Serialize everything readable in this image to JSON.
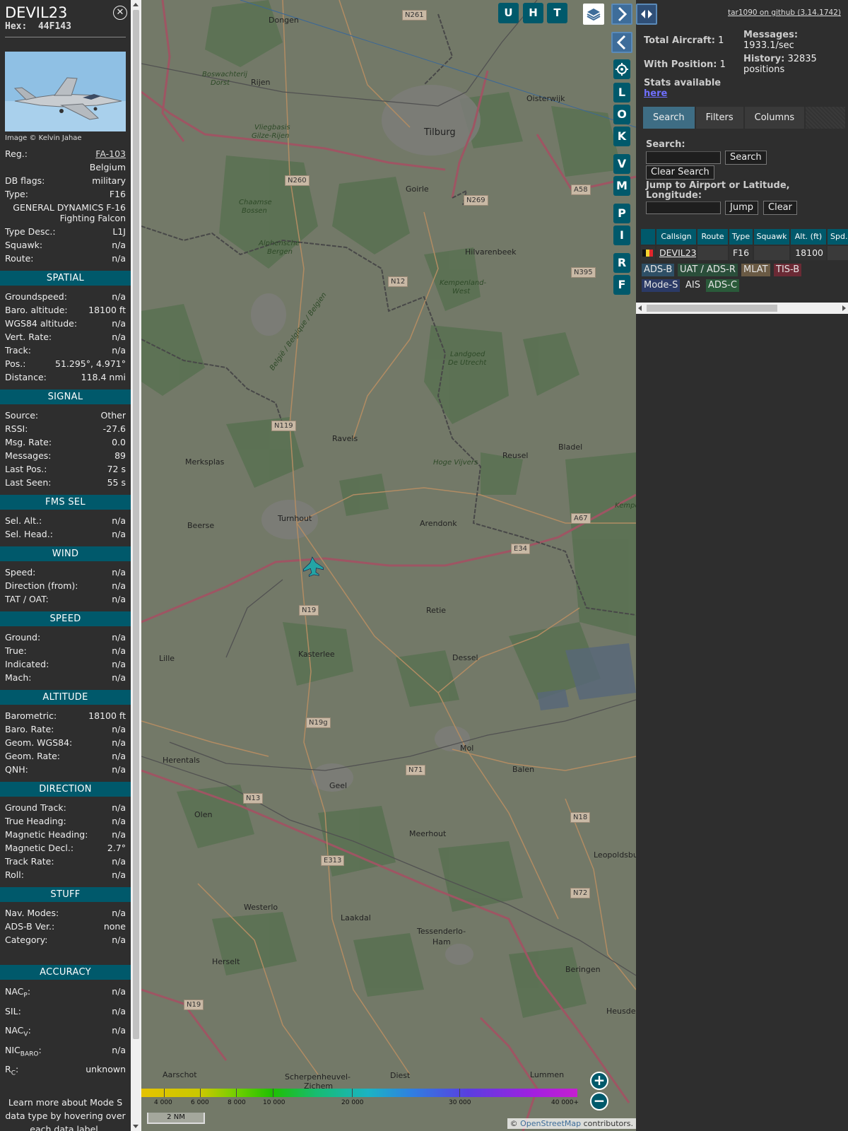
{
  "info": {
    "callsign": "DEVIL23",
    "hex_label": "Hex:",
    "hex": "44F143",
    "photo_credit": "Image © Kelvin Jahae",
    "close_icon": "close-icon",
    "top": [
      {
        "label": "Reg.:",
        "value": "FA-103",
        "link": true
      },
      {
        "label": "",
        "value": "Belgium"
      },
      {
        "label": "DB flags:",
        "value": "military"
      },
      {
        "label": "Type:",
        "value": "F16"
      },
      {
        "label": "",
        "value": "GENERAL DYNAMICS F-16 Fighting Falcon",
        "wrap": true
      },
      {
        "label": "Type Desc.:",
        "value": "L1J"
      },
      {
        "label": "Squawk:",
        "value": "n/a"
      },
      {
        "label": "Route:",
        "value": "n/a"
      }
    ],
    "sections": [
      {
        "title": "SPATIAL",
        "rows": [
          {
            "label": "Groundspeed:",
            "value": "n/a"
          },
          {
            "label": "Baro. altitude:",
            "value": "18100 ft"
          },
          {
            "label": "WGS84 altitude:",
            "value": "n/a"
          },
          {
            "label": "Vert. Rate:",
            "value": "n/a"
          },
          {
            "label": "Track:",
            "value": "n/a"
          },
          {
            "label": "Pos.:",
            "value": "51.295°, 4.971°"
          },
          {
            "label": "Distance:",
            "value": "118.4 nmi"
          }
        ]
      },
      {
        "title": "SIGNAL",
        "rows": [
          {
            "label": "Source:",
            "value": "Other"
          },
          {
            "label": "RSSI:",
            "value": "-27.6"
          },
          {
            "label": "Msg. Rate:",
            "value": "0.0"
          },
          {
            "label": "Messages:",
            "value": "89"
          },
          {
            "label": "Last Pos.:",
            "value": "72 s"
          },
          {
            "label": "Last Seen:",
            "value": "55 s"
          }
        ]
      },
      {
        "title": "FMS SEL",
        "rows": [
          {
            "label": "Sel. Alt.:",
            "value": "n/a"
          },
          {
            "label": "Sel. Head.:",
            "value": "n/a"
          }
        ]
      },
      {
        "title": "WIND",
        "rows": [
          {
            "label": "Speed:",
            "value": "n/a"
          },
          {
            "label": "Direction (from):",
            "value": "n/a"
          },
          {
            "label": "TAT / OAT:",
            "value": "n/a"
          }
        ]
      },
      {
        "title": "SPEED",
        "rows": [
          {
            "label": "Ground:",
            "value": "n/a"
          },
          {
            "label": "True:",
            "value": "n/a"
          },
          {
            "label": "Indicated:",
            "value": "n/a"
          },
          {
            "label": "Mach:",
            "value": "n/a"
          }
        ]
      },
      {
        "title": "ALTITUDE",
        "rows": [
          {
            "label": "Barometric:",
            "value": "18100 ft"
          },
          {
            "label": "Baro. Rate:",
            "value": "n/a"
          },
          {
            "label": "Geom. WGS84:",
            "value": "n/a"
          },
          {
            "label": "Geom. Rate:",
            "value": "n/a"
          },
          {
            "label": "QNH:",
            "value": "n/a"
          }
        ]
      },
      {
        "title": "DIRECTION",
        "rows": [
          {
            "label": "Ground Track:",
            "value": "n/a"
          },
          {
            "label": "True Heading:",
            "value": "n/a"
          },
          {
            "label": "Magnetic Heading:",
            "value": "n/a"
          },
          {
            "label": "Magnetic Decl.:",
            "value": "2.7°"
          },
          {
            "label": "Track Rate:",
            "value": "n/a"
          },
          {
            "label": "Roll:",
            "value": "n/a"
          }
        ]
      },
      {
        "title": "STUFF",
        "rows": [
          {
            "label": "Nav. Modes:",
            "value": "n/a"
          },
          {
            "label": "ADS-B Ver.:",
            "value": "none"
          },
          {
            "label": "Category:",
            "value": "n/a"
          }
        ]
      }
    ],
    "accuracy": {
      "title": "ACCURACY",
      "rows": [
        {
          "label": "NAC",
          "sub": "P",
          "tail": ":",
          "value": "n/a"
        },
        {
          "label": "SIL:",
          "sub": "",
          "tail": "",
          "value": "n/a"
        },
        {
          "label": "NAC",
          "sub": "V",
          "tail": ":",
          "value": "n/a"
        },
        {
          "label": "NIC",
          "sub": "BARO",
          "tail": ":",
          "value": "n/a"
        },
        {
          "label": "R",
          "sub": "C",
          "tail": ":",
          "value": "unknown"
        }
      ]
    },
    "learn_more": "Learn more about Mode S data type by hovering over each data label."
  },
  "map": {
    "buttons_top": [
      "U",
      "H",
      "T"
    ],
    "buttons_side": [
      "L",
      "O",
      "K",
      "V",
      "M",
      "P",
      "I",
      "R",
      "F"
    ],
    "labels": [
      {
        "t": "Dongen"
      },
      {
        "t": "Tilburg"
      },
      {
        "t": "Oisterwijk"
      },
      {
        "t": "Rijen"
      },
      {
        "t": "Goirle"
      },
      {
        "t": "Hilvarenbeek"
      },
      {
        "t": "Ravels"
      },
      {
        "t": "Merksplas"
      },
      {
        "t": "Reusel"
      },
      {
        "t": "Bladel"
      },
      {
        "t": "Turnhout"
      },
      {
        "t": "Beerse"
      },
      {
        "t": "Arendonk"
      },
      {
        "t": "Retie"
      },
      {
        "t": "Lille"
      },
      {
        "t": "Kasterlee"
      },
      {
        "t": "Dessel"
      },
      {
        "t": "Mol"
      },
      {
        "t": "Balen"
      },
      {
        "t": "Herentals"
      },
      {
        "t": "Geel"
      },
      {
        "t": "Olen"
      },
      {
        "t": "Meerhout"
      },
      {
        "t": "Leopoldsbu"
      },
      {
        "t": "Westerlo"
      },
      {
        "t": "Laakdal"
      },
      {
        "t": "Tessenderlo-"
      },
      {
        "t": "Ham"
      },
      {
        "t": "Herselt"
      },
      {
        "t": "Beringen"
      },
      {
        "t": "Heusden"
      },
      {
        "t": "Aarschot"
      },
      {
        "t": "Scherpenheuvel-"
      },
      {
        "t": "Zichem"
      },
      {
        "t": "Diest"
      },
      {
        "t": "Lummen"
      }
    ],
    "italic_labels": [
      {
        "t": "Boswachterij"
      },
      {
        "t": "Dorst"
      },
      {
        "t": "Vliegbasis"
      },
      {
        "t": "Gilze-Rijen"
      },
      {
        "t": "Chaamse"
      },
      {
        "t": "Bossen"
      },
      {
        "t": "Alphensche"
      },
      {
        "t": "Bergen"
      },
      {
        "t": "Kempenland-"
      },
      {
        "t": "West"
      },
      {
        "t": "Landgoed"
      },
      {
        "t": "De Utrecht"
      },
      {
        "t": "Hoge Vijvers"
      },
      {
        "t": "België / Belgique / Belgien"
      },
      {
        "t": "Kemper"
      }
    ],
    "road_badges": [
      "N261",
      "N260",
      "N269",
      "A58",
      "N12",
      "N395",
      "N119",
      "A67",
      "E34",
      "N19",
      "N19g",
      "N71",
      "N13",
      "N18",
      "E313",
      "N72",
      "N19"
    ],
    "colorbar_ticks": [
      "4 000",
      "6 000",
      "8 000",
      "10 000",
      "20 000",
      "30 000",
      "40 000+"
    ],
    "scale": "2 NM",
    "attribution_prefix": "©",
    "attribution_link": "OpenStreetMap",
    "attribution_suffix": " contributors."
  },
  "sidebar": {
    "github": "tar1090 on github (3.14.1742)",
    "total_label": "Total Aircraft:",
    "total_value": "1",
    "with_pos_label": "With Position:",
    "with_pos_value": "1",
    "stats_label": "Stats available",
    "stats_link": "here",
    "messages_label": "Messages:",
    "messages_value": "1933.1/sec",
    "history_label": "History:",
    "history_value": "32835 positions",
    "tabs": [
      "Search",
      "Filters",
      "Columns"
    ],
    "search_label": "Search:",
    "search_button": "Search",
    "clear_search": "Clear Search",
    "jump_label": "Jump to Airport or Latitude, Longitude:",
    "jump_button": "Jump",
    "clear_button": "Clear",
    "columns": [
      "Callsign",
      "Route",
      "Type",
      "Squawk",
      "Alt. (ft)",
      "Spd."
    ],
    "row": {
      "callsign": "DEVIL23",
      "route": "",
      "type": "F16",
      "squawk": "",
      "alt": "18100",
      "spd": ""
    },
    "legend": [
      {
        "t": "ADS-B",
        "bg": "#2e4f66",
        "fg": "#e6e6e6"
      },
      {
        "t": "UAT / ADS-R",
        "bg": "#2a4e3a",
        "fg": "#e6e6e6"
      },
      {
        "t": "MLAT",
        "bg": "#6a5a44",
        "fg": "#e6e6e6"
      },
      {
        "t": "TIS-B",
        "bg": "#6b2a35",
        "fg": "#e6e6e6"
      },
      {
        "t": "Mode-S",
        "bg": "#2b3a66",
        "fg": "#e6e6e6"
      },
      {
        "t": "AIS",
        "bg": "#2e2e2e",
        "fg": "#e6e6e6"
      },
      {
        "t": "ADS-C",
        "bg": "#2a5a3a",
        "fg": "#e6e6e6"
      }
    ]
  }
}
